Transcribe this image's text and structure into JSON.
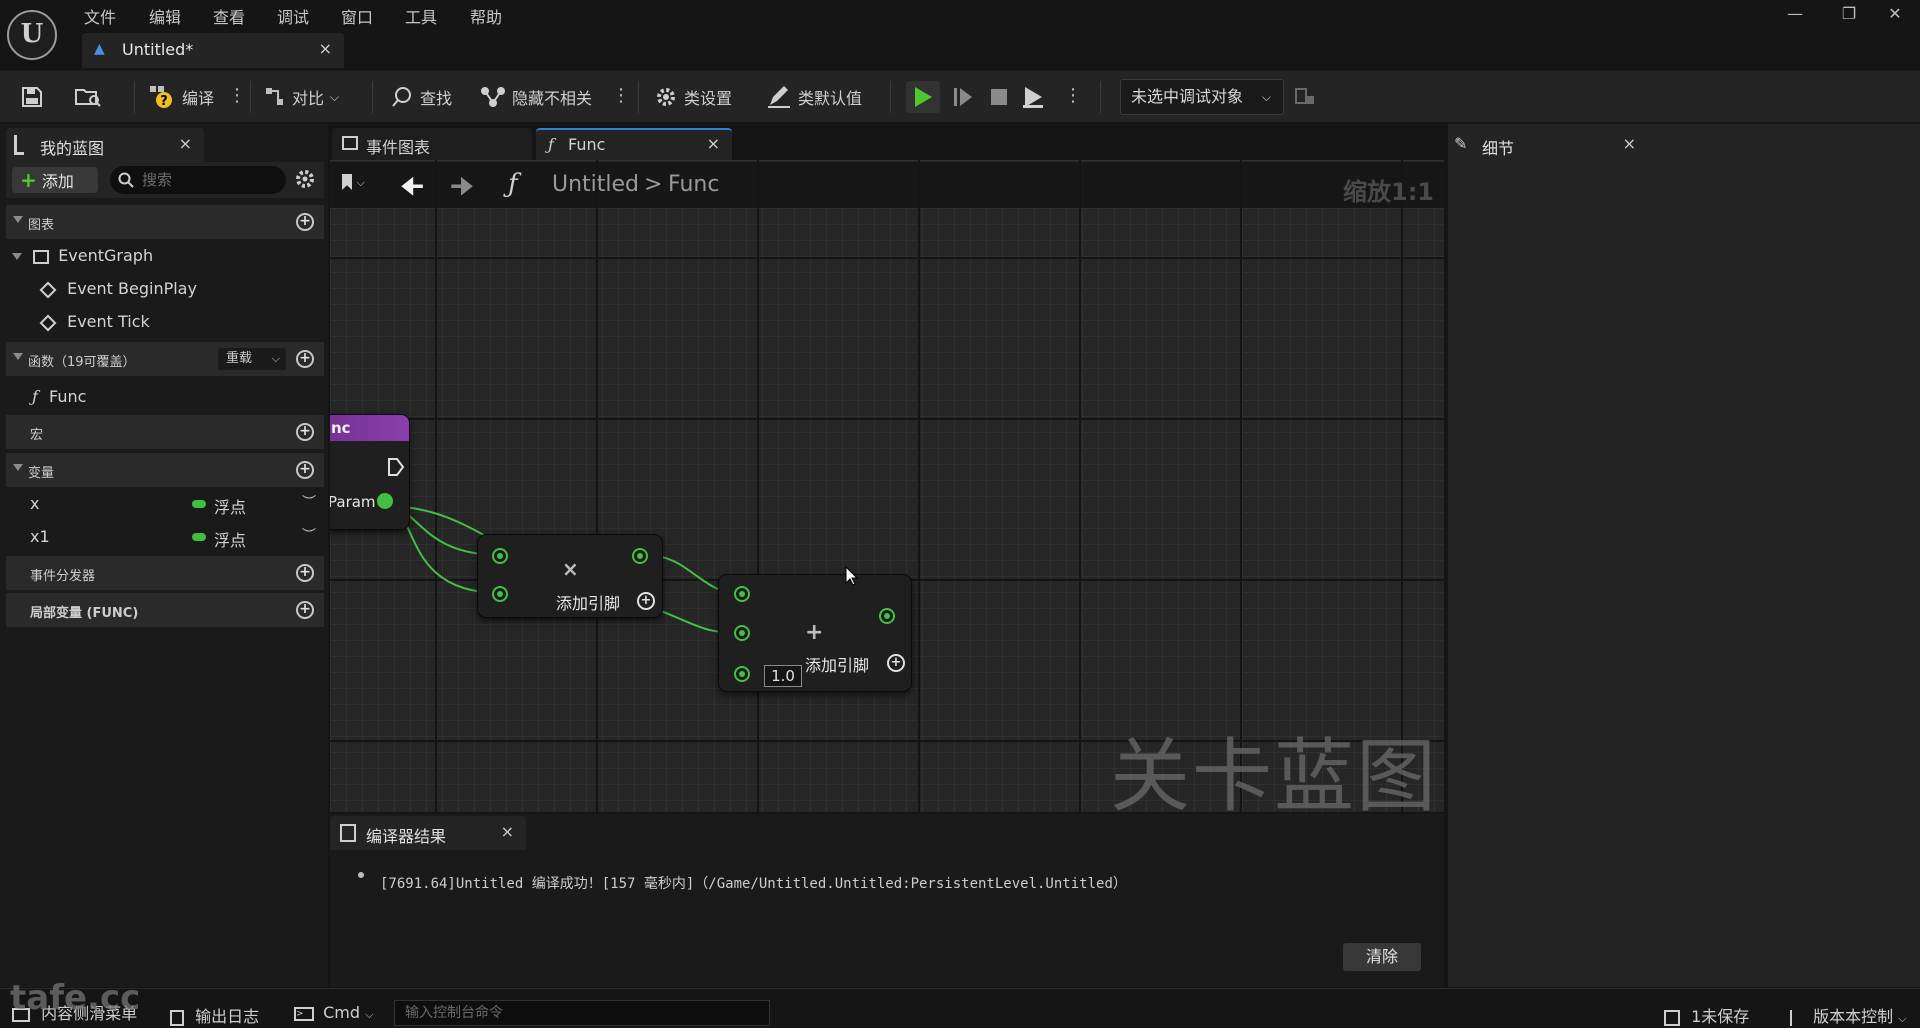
{
  "menu": [
    "文件",
    "编辑",
    "查看",
    "调试",
    "窗口",
    "工具",
    "帮助"
  ],
  "logo_text": "U",
  "document_tab": {
    "label": "Untitled*",
    "close": "×"
  },
  "window_controls": {
    "minimize": "—",
    "restore": "❐",
    "close": "✕"
  },
  "toolbar": {
    "compile": "编译",
    "diff": "对比",
    "find": "查找",
    "hide_unrelated": "隐藏不相关",
    "class_settings": "类设置",
    "class_defaults": "类默认值",
    "debug_target": "未选中调试对象",
    "play_color": "#4fc72f"
  },
  "my_blueprint": {
    "tab_title": "我的蓝图",
    "add_label": "添加",
    "search_placeholder": "搜索",
    "sections": {
      "graphs": "图表",
      "functions": "函数（19可覆盖）",
      "override": "重载",
      "macros": "宏",
      "variables": "变量",
      "event_dispatchers": "事件分发器",
      "local_variables": "局部变量 (FUNC)"
    },
    "graph_items": {
      "event_graph": "EventGraph",
      "begin_play": "Event BeginPlay",
      "tick": "Event Tick"
    },
    "function_items": [
      "Func"
    ],
    "variables": [
      {
        "name": "x",
        "type": "浮点"
      },
      {
        "name": "x1",
        "type": "浮点"
      }
    ]
  },
  "graph_tabs": [
    {
      "label": "事件图表"
    },
    {
      "label": "Func",
      "icon": "ƒ"
    }
  ],
  "breadcrumb": {
    "root": "Untitled",
    "sep": ">",
    "leaf": "Func",
    "zoom": "缩放1:1"
  },
  "nodes": {
    "entry": {
      "title": "nc",
      "param": "Param"
    },
    "multiply": {
      "symbol": "×",
      "add_pin": "添加引脚"
    },
    "add": {
      "symbol": "+",
      "add_pin": "添加引脚",
      "default_value": "1.0"
    }
  },
  "watermark": "关卡蓝图",
  "compiler": {
    "tab_title": "编译器结果",
    "message": "[7691.64]Untitled 编译成功！[157 毫秒内]（/Game/Untitled.Untitled:PersistentLevel.Untitled）",
    "clear": "清除"
  },
  "details": {
    "tab_title": "细节"
  },
  "statusbar": {
    "content_drawer": "内容侧滑菜单",
    "output_log": "输出日志",
    "cmd": "Cmd",
    "console_placeholder": "输入控制台命令",
    "unsaved": "1未保存",
    "source_control": "版本本控制"
  },
  "watermark_site": "tafe.cc"
}
